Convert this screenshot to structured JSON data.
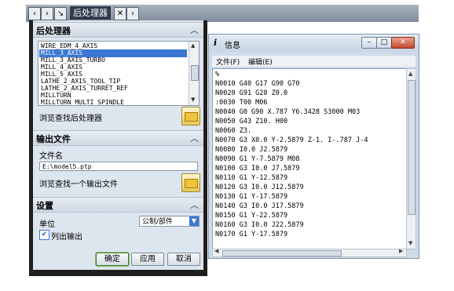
{
  "toolbar": {
    "back_glyph": "‹",
    "forward_glyph": "›",
    "pin_glyph": "↘",
    "title": "后处理器",
    "close_glyph": "✕",
    "next_glyph": "›"
  },
  "dialog": {
    "postprocessor_section": {
      "title": "后处理器",
      "items": [
        "WIRE_EDM_4_AXIS",
        "MILL_3_AXIS",
        "MILL_3_AXIS_TURBO",
        "MILL_4_AXIS",
        "MILL_5_AXIS",
        "LATHE_2_AXIS_TOOL_TIP",
        "LATHE_2_AXIS_TURRET_REF",
        "MILLTURN",
        "MILLTURN_MULTI_SPINDLE"
      ],
      "selected": "MILL_3_AXIS",
      "browse_label": "浏览查找后处理器"
    },
    "output_section": {
      "title": "输出文件",
      "filename_label": "文件名",
      "filename_value": "E:\\model5.ptp",
      "browse_label": "浏览查找一个输出文件"
    },
    "settings_section": {
      "title": "设置",
      "unit_label": "单位",
      "unit_value": "公制/部件",
      "list_output_label": "列出输出",
      "list_output_checked": true
    },
    "buttons": {
      "ok": "确定",
      "apply": "应用",
      "cancel": "取消"
    }
  },
  "info_window": {
    "icon_glyph": "i",
    "title": "信息",
    "minimize": "–",
    "maximize": "□",
    "close": "✕",
    "menu": [
      "文件(F)",
      "编辑(E)"
    ],
    "code_lines": [
      "%",
      "N0010 G40 G17 G90 G70",
      "N0020 G91 G28 Z0.0",
      ":0030 T00 M06",
      "N0040 G0 G90 X.787 Y6.3428 S3000 M03",
      "N0050 G43 Z10. H00",
      "N0060 Z3.",
      "N0070 G3 X0.0 Y-2.5879 Z-1. I-.787 J-4",
      "N0080 I0.0 J2.5879",
      "N0090 G1 Y-7.5879 M08",
      "N0100 G3 I0.0 J7.5879",
      "N0110 G1 Y-12.5879",
      "N0120 G3 I0.0 J12.5879",
      "N0130 G1 Y-17.5879",
      "N0140 G3 I0.0 J17.5879",
      "N0150 G1 Y-22.5879",
      "N0160 G3 I0.0 J22.5879",
      "N0170 G1 Y-17.5879"
    ]
  }
}
